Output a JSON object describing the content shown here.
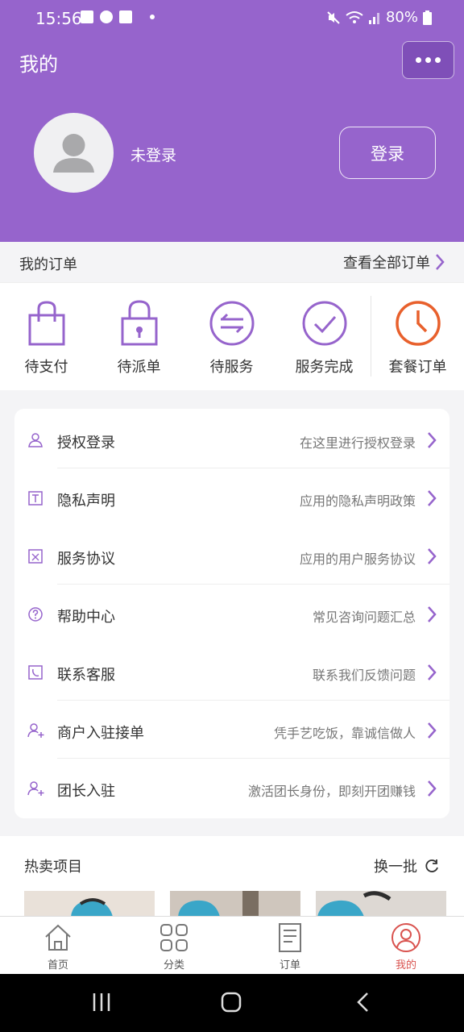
{
  "status_bar": {
    "time": "15:56",
    "battery": "80%"
  },
  "header": {
    "title": "我的",
    "more_icon": "more-dots-icon"
  },
  "profile": {
    "username": "未登录",
    "login_label": "登录"
  },
  "orders": {
    "title": "我的订单",
    "view_all": "查看全部订单",
    "items": [
      {
        "label": "待支付",
        "icon": "shopping-bag-icon"
      },
      {
        "label": "待派单",
        "icon": "lock-icon"
      },
      {
        "label": "待服务",
        "icon": "exchange-icon"
      },
      {
        "label": "服务完成",
        "icon": "check-circle-icon"
      },
      {
        "label": "套餐订单",
        "icon": "clock-icon"
      }
    ]
  },
  "menu": [
    {
      "label": "授权登录",
      "desc": "在这里进行授权登录",
      "icon": "user-icon"
    },
    {
      "label": "隐私声明",
      "desc": "应用的隐私声明政策",
      "icon": "text-box-icon"
    },
    {
      "label": "服务协议",
      "desc": "应用的用户服务协议",
      "icon": "document-icon"
    },
    {
      "label": "帮助中心",
      "desc": "常见咨询问题汇总",
      "icon": "question-icon"
    },
    {
      "label": "联系客服",
      "desc": "联系我们反馈问题",
      "icon": "phone-icon"
    },
    {
      "label": "商户入驻接单",
      "desc": "凭手艺吃饭，靠诚信做人",
      "icon": "add-user-icon"
    },
    {
      "label": "团长入驻",
      "desc": "激活团长身份，即刻开团赚钱",
      "icon": "add-user-icon"
    }
  ],
  "hot": {
    "title": "热卖项目",
    "refresh_label": "换一批"
  },
  "tabbar": [
    {
      "label": "首页",
      "icon": "home-icon"
    },
    {
      "label": "分类",
      "icon": "grid-icon"
    },
    {
      "label": "订单",
      "icon": "order-list-icon"
    },
    {
      "label": "我的",
      "icon": "profile-icon",
      "active": true
    }
  ],
  "colors": {
    "brand": "#9664cc",
    "active_tab": "#d9534f",
    "package_accent": "#e8602c"
  }
}
